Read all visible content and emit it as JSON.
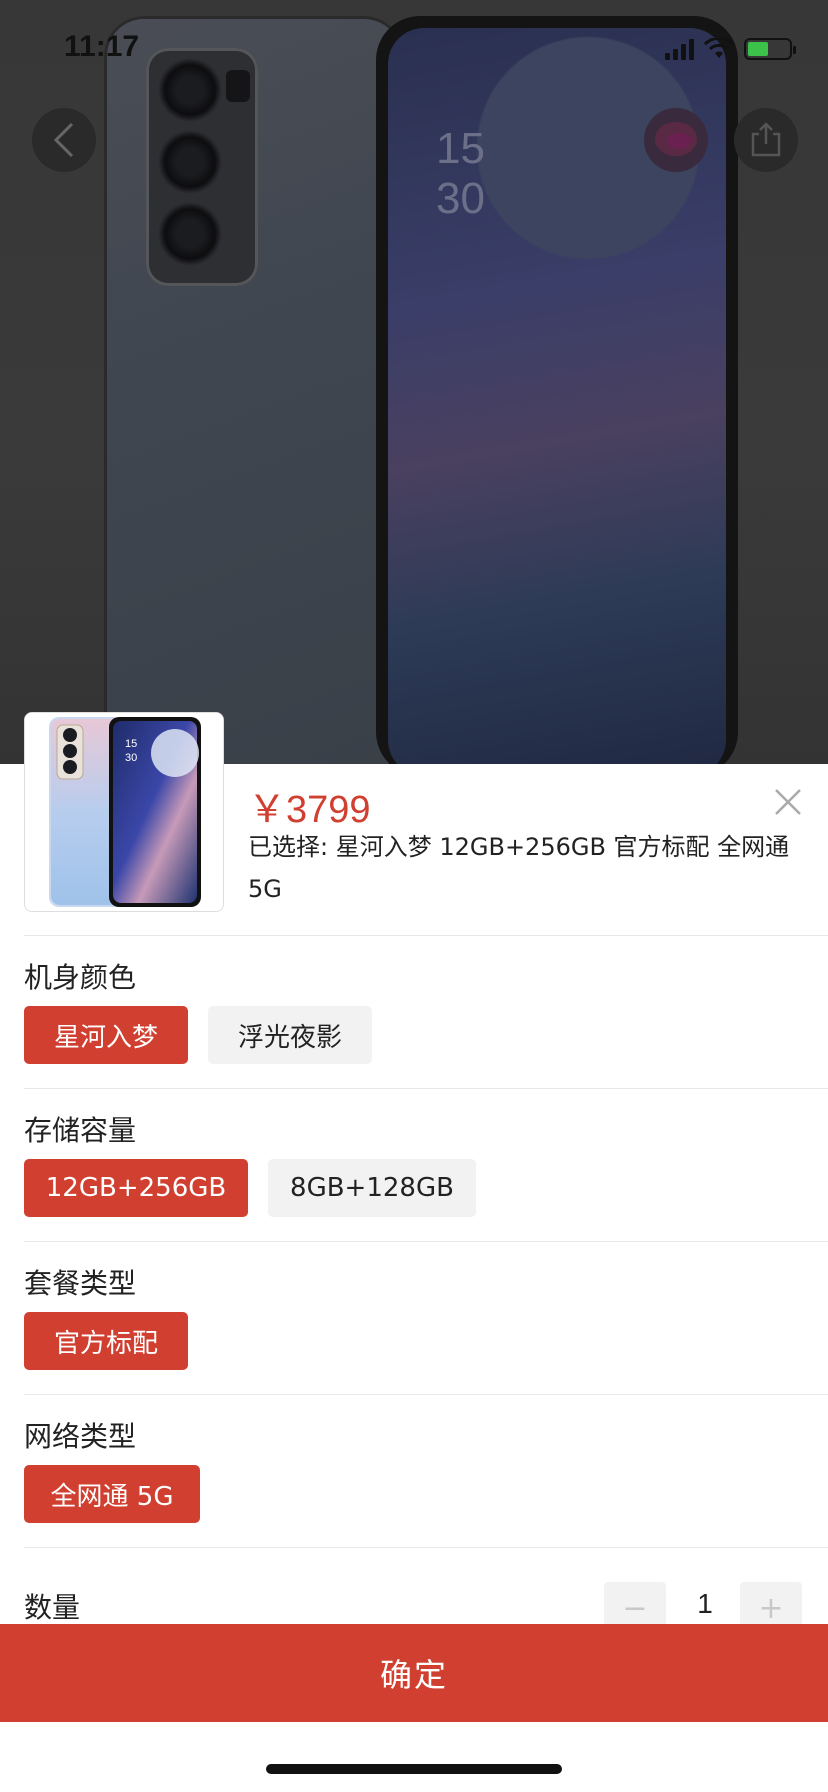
{
  "status_bar": {
    "time": "11:17"
  },
  "backdrop": {
    "clock_hour": "15",
    "clock_minute": "30"
  },
  "sheet": {
    "price": "￥3799",
    "selected_text": "已选择: 星河入梦 12GB+256GB 官方标配 全网通 5G",
    "groups": [
      {
        "title": "机身颜色",
        "options": [
          "星河入梦",
          "浮光夜影"
        ],
        "selected": "星河入梦"
      },
      {
        "title": "存储容量",
        "options": [
          "12GB+256GB",
          "8GB+128GB"
        ],
        "selected": "12GB+256GB"
      },
      {
        "title": "套餐类型",
        "options": [
          "官方标配"
        ],
        "selected": "官方标配"
      },
      {
        "title": "网络类型",
        "options": [
          "全网通 5G"
        ],
        "selected": "全网通 5G"
      }
    ],
    "quantity": {
      "label": "数量",
      "value": "1",
      "minus": "−",
      "plus": "+"
    },
    "confirm_label": "确定"
  },
  "colors": {
    "accent": "#d03f2f",
    "chip_unselected": "#f2f2f2",
    "backdrop": "#383838"
  },
  "icons": [
    "back-arrow-icon",
    "share-icon",
    "close-icon",
    "signal-icon",
    "wifi-icon",
    "battery-icon"
  ]
}
